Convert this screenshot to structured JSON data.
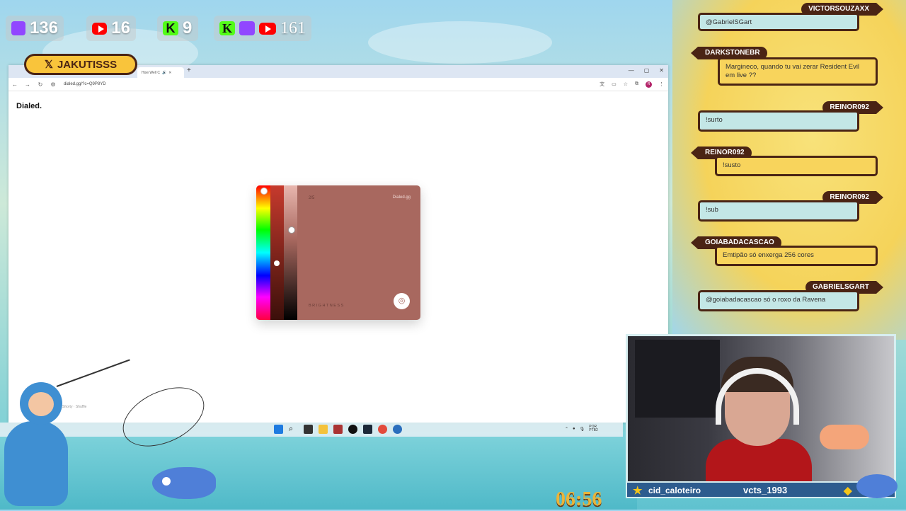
{
  "counters": [
    {
      "platform": "twitch",
      "value": "136"
    },
    {
      "platform": "youtube",
      "value": "16"
    },
    {
      "platform": "kick",
      "value": "9"
    },
    {
      "platform": "all",
      "value": "161"
    }
  ],
  "x_badge": {
    "handle": "JAKUTISSS"
  },
  "browser": {
    "tab_title": "How Well C",
    "url": "dialed.gg/?c=Q9P8YD",
    "avatar_letter": "R",
    "page": {
      "logo": "Dialed.",
      "card": {
        "progress": "2/5",
        "brand": "Dialed.gg",
        "mode_label": "BRIGHTNESS",
        "swatch_color": "#a8685f"
      },
      "bottom_hint": "Shorty · Shuffle"
    }
  },
  "taskbar": {
    "tray_lang": "POR",
    "tray_region": "PTB2"
  },
  "chat": [
    {
      "user": "VICTORSOUZAXX",
      "text": "@GabrielSGart",
      "style": "blue",
      "side": "right"
    },
    {
      "user": "DARKSTONEBR",
      "text": "Margineco, quando tu vai zerar Resident Evil em live ??",
      "style": "yellow",
      "side": "left"
    },
    {
      "user": "REINOR092",
      "text": "!surto",
      "style": "blue",
      "side": "right"
    },
    {
      "user": "REINOR092",
      "text": "!susto",
      "style": "yellow",
      "side": "left"
    },
    {
      "user": "REINOR092",
      "text": "!sub",
      "style": "blue",
      "side": "right"
    },
    {
      "user": "GOIABADACASCAO",
      "text": "Emtipão só enxerga 256 cores",
      "style": "yellow",
      "side": "left"
    },
    {
      "user": "GABRIELSGART",
      "text": "@goiabadacascao só o roxo da Ravena",
      "style": "blue",
      "side": "right"
    }
  ],
  "webcam": {
    "bar_left_name": "cid_caloteiro",
    "bar_right_name": "vcts_1993"
  },
  "timer": "06:56"
}
